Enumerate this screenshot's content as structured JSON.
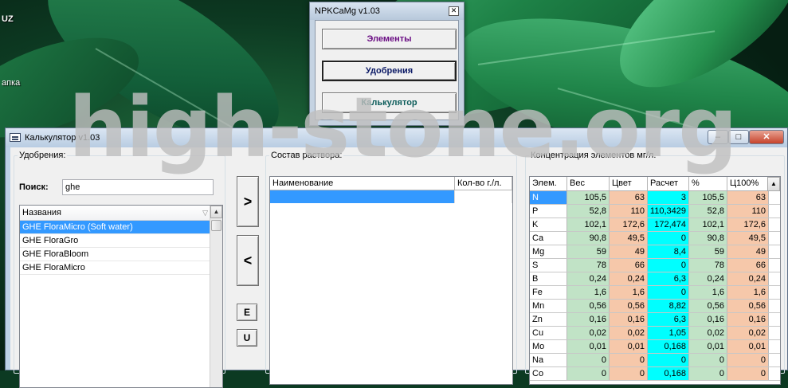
{
  "desktop": {
    "label_top": "UZ",
    "label_mid": "апка"
  },
  "npk_window": {
    "title": "NPKCaMg v1.03",
    "buttons": {
      "elements": "Элементы",
      "fertilizers": "Удобрения",
      "calculator": "Калькулятор"
    }
  },
  "calc_window": {
    "title": "Калькулятор v1.03",
    "controls": {
      "minimize": "–",
      "maximize": "□",
      "close": "✕"
    },
    "fertilizers_group": {
      "legend": "Удобрения:",
      "search_label": "Поиск:",
      "search_value": "ghe",
      "list_header": "Названия",
      "items": [
        "GHE FloraMicro (Soft water)",
        "GHE FloraGro",
        "GHE FloraBloom",
        "GHE FloraMicro"
      ]
    },
    "move_buttons": {
      "add": ">",
      "remove": "<",
      "e": "E",
      "u": "U"
    },
    "composition_group": {
      "legend": "Состав раствора:",
      "col_name": "Наименование",
      "col_qty": "Кол-во г./л."
    },
    "concentration_group": {
      "legend": "Концентрация элементов мг/л.",
      "headers": [
        "Элем.",
        "Вес",
        "Цвет",
        "Расчет",
        "%",
        "Ц100%"
      ],
      "rows": [
        [
          "N",
          "105,5",
          "63",
          "3",
          "105,5",
          "63"
        ],
        [
          "P",
          "52,8",
          "110",
          "110,3429",
          "52,8",
          "110"
        ],
        [
          "K",
          "102,1",
          "172,6",
          "172,474",
          "102,1",
          "172,6"
        ],
        [
          "Ca",
          "90,8",
          "49,5",
          "0",
          "90,8",
          "49,5"
        ],
        [
          "Mg",
          "59",
          "49",
          "8,4",
          "59",
          "49"
        ],
        [
          "S",
          "78",
          "66",
          "0",
          "78",
          "66"
        ],
        [
          "B",
          "0,24",
          "0,24",
          "6,3",
          "0,24",
          "0,24"
        ],
        [
          "Fe",
          "1,6",
          "1,6",
          "0",
          "1,6",
          "1,6"
        ],
        [
          "Mn",
          "0,56",
          "0,56",
          "8,82",
          "0,56",
          "0,56"
        ],
        [
          "Zn",
          "0,16",
          "0,16",
          "6,3",
          "0,16",
          "0,16"
        ],
        [
          "Cu",
          "0,02",
          "0,02",
          "1,05",
          "0,02",
          "0,02"
        ],
        [
          "Mo",
          "0,01",
          "0,01",
          "0,168",
          "0,01",
          "0,01"
        ],
        [
          "Na",
          "0",
          "0",
          "0",
          "0",
          "0"
        ],
        [
          "Co",
          "0",
          "0",
          "0,168",
          "0",
          "0"
        ]
      ],
      "column_colors": [
        "#ffffff",
        "#c1e3c6",
        "#f6c8aa",
        "#00ffff",
        "#c1e3c6",
        "#f6c8aa"
      ]
    }
  },
  "watermark": "high-stone.org"
}
